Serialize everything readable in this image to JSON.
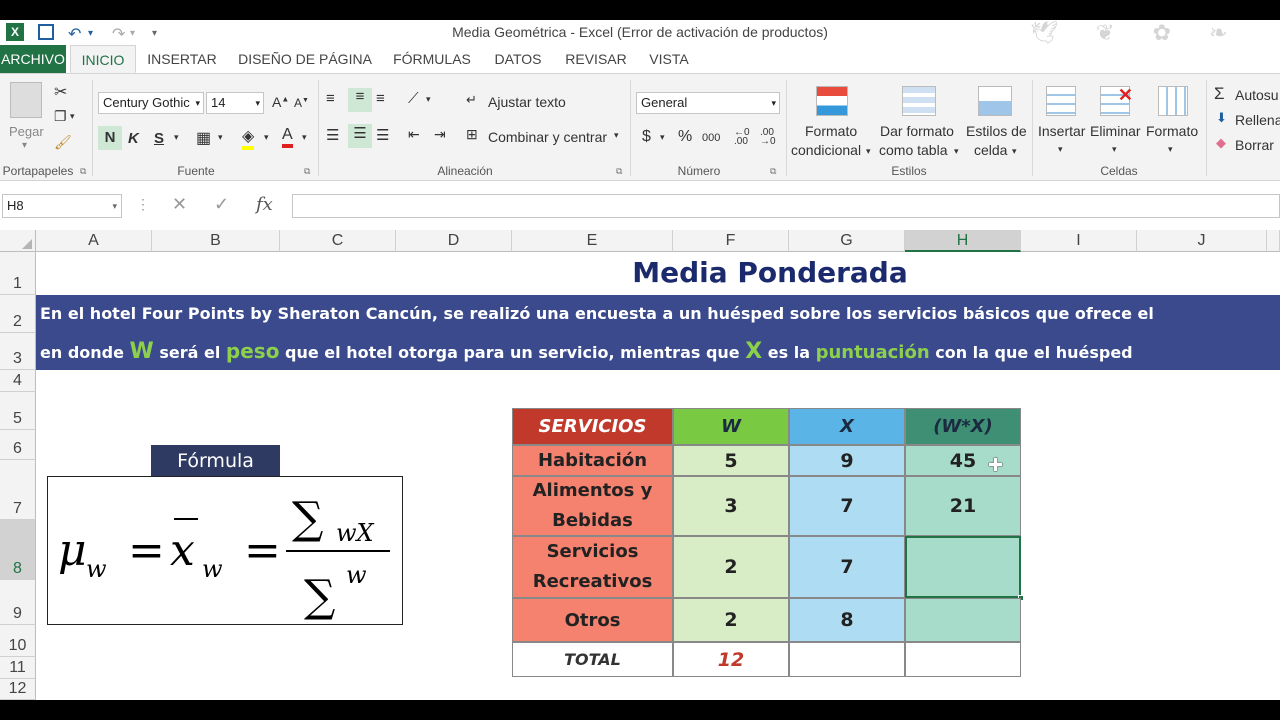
{
  "window": {
    "title": "Media Geométrica - Excel (Error de activación de productos)"
  },
  "tabs": [
    "ARCHIVO",
    "INICIO",
    "INSERTAR",
    "DISEÑO DE PÁGINA",
    "FÓRMULAS",
    "DATOS",
    "REVISAR",
    "VISTA"
  ],
  "ribbon": {
    "clipboard": {
      "paste": "Pegar",
      "label": "Portapapeles"
    },
    "font": {
      "name": "Century Gothic",
      "size": "14",
      "bold": "N",
      "italic": "K",
      "underline": "S",
      "label": "Fuente"
    },
    "alignment": {
      "wrap": "Ajustar texto",
      "merge": "Combinar y centrar",
      "label": "Alineación"
    },
    "number": {
      "format": "General",
      "currency": "$",
      "percent": "%",
      "thousands": "000",
      "label": "Número"
    },
    "styles": {
      "cond1": "Formato",
      "cond2": "condicional",
      "table1": "Dar formato",
      "table2": "como tabla",
      "cell1": "Estilos de",
      "cell2": "celda",
      "label": "Estilos"
    },
    "cells": {
      "insert": "Insertar",
      "delete": "Eliminar",
      "format": "Formato",
      "label": "Celdas"
    },
    "editing": {
      "autosum": "Autosu",
      "fill": "Rellena",
      "clear": "Borrar"
    }
  },
  "formula_bar": {
    "name_box": "H8",
    "fx": "fx",
    "content": ""
  },
  "columns": [
    "A",
    "B",
    "C",
    "D",
    "E",
    "F",
    "G",
    "H",
    "I",
    "J"
  ],
  "rows": [
    "1",
    "2",
    "3",
    "4",
    "5",
    "6",
    "7",
    "8",
    "9",
    "10",
    "11",
    "12"
  ],
  "sheet": {
    "title": "Media Ponderada",
    "line2": "En el hotel Four Points by Sheraton Cancún, se realizó una encuesta a un huésped sobre los servicios básicos que ofrece el",
    "line3": {
      "p1": "en donde ",
      "w": "W",
      "p2": " será el ",
      "peso": "peso",
      "p3": " que el hotel otorga para un servicio, mientras que ",
      "x": "X",
      "p4": " es la ",
      "punt": "puntuación",
      "p5": " con la que el huésped"
    },
    "formula_label": "Fórmula",
    "table": {
      "headers": [
        "SERVICIOS",
        "W",
        "X",
        "(W*X)"
      ],
      "rows": [
        [
          "Habitación",
          "5",
          "9",
          "45"
        ],
        [
          "Alimentos y\nBebidas",
          "3",
          "7",
          "21"
        ],
        [
          "Servicios\nRecreativos",
          "2",
          "7",
          ""
        ],
        [
          "Otros",
          "2",
          "8",
          ""
        ]
      ],
      "total_label": "TOTAL",
      "total_w": "12"
    }
  },
  "colors": {
    "excel_green": "#217346",
    "banner": "#3a4a8c",
    "header_red": "#c0392b",
    "header_green": "#7ac943",
    "header_blue": "#5ab4e5",
    "header_teal": "#3f8f74",
    "peso_green": "#8cd04b"
  }
}
